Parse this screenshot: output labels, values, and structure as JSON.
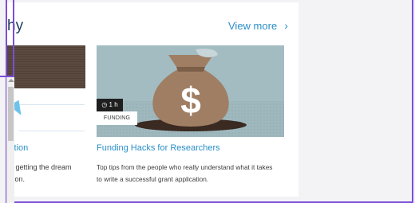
{
  "section": {
    "title": "hy",
    "view_more": "View more",
    "chevron": "›"
  },
  "left_card": {
    "title": "dition",
    "desc_line1": "or getting the dream",
    "desc_line2": "ation."
  },
  "main_card": {
    "duration": "1 h",
    "category": "FUNDING",
    "title": "Funding Hacks for Researchers",
    "desc_line1": "Top tips from the people who really understand what it takes",
    "desc_line2": "to write a successful grant application."
  },
  "colors": {
    "accent": "#2a8fc9",
    "frame": "#7c4ed8",
    "title": "#1d3a5c"
  }
}
